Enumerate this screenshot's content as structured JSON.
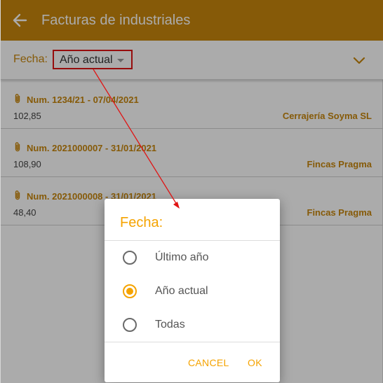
{
  "header": {
    "title": "Facturas de industriales",
    "back_icon": "arrow-left-icon"
  },
  "filter": {
    "label": "Fecha:",
    "value": "Año actual",
    "expand_icon": "chevron-down-icon"
  },
  "invoices": [
    {
      "number": "Num. 1234/21 - 07/04/2021",
      "amount": "102,85",
      "client": "Cerrajería Soyma SL"
    },
    {
      "number": "Num. 2021000007 - 31/01/2021",
      "amount": "108,90",
      "client": "Fincas Pragma"
    },
    {
      "number": "Num. 2021000008 - 31/01/2021",
      "amount": "48,40",
      "client": "Fincas Pragma"
    }
  ],
  "dialog": {
    "title": "Fecha:",
    "options": [
      {
        "label": "Último año",
        "selected": false
      },
      {
        "label": "Año actual",
        "selected": true
      },
      {
        "label": "Todas",
        "selected": false
      }
    ],
    "cancel_label": "CANCEL",
    "ok_label": "OK"
  },
  "colors": {
    "primary": "#c8870c",
    "accent": "#f5a300",
    "annotation": "#e01414"
  }
}
